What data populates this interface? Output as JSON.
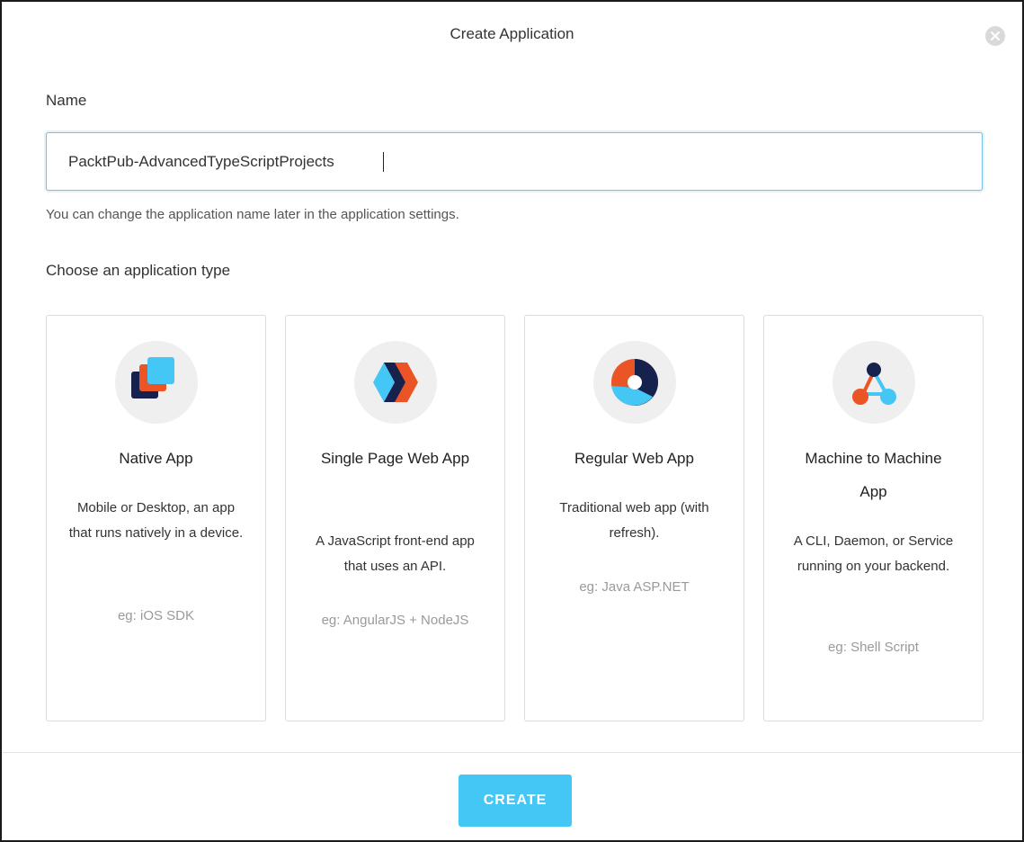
{
  "dialog": {
    "title": "Create Application",
    "close_icon": "close-icon"
  },
  "name_field": {
    "label": "Name",
    "value": "PacktPub-AdvancedTypeScriptProjects",
    "hint": "You can change the application name later in the application settings."
  },
  "app_type": {
    "label": "Choose an application type",
    "cards": [
      {
        "icon": "native-app-icon",
        "title": "Native App",
        "description": "Mobile or Desktop, an app that runs natively in a device.",
        "example": "eg: iOS SDK"
      },
      {
        "icon": "single-page-app-icon",
        "title": "Single Page Web App",
        "description": "A JavaScript front-end app that uses an API.",
        "example": "eg: AngularJS + NodeJS"
      },
      {
        "icon": "regular-web-app-icon",
        "title": "Regular Web App",
        "description": "Traditional web app (with refresh).",
        "example": "eg: Java ASP.NET"
      },
      {
        "icon": "machine-to-machine-icon",
        "title": "Machine to Machine App",
        "description": "A CLI, Daemon, or Service running on your backend.",
        "example": "eg: Shell Script"
      }
    ]
  },
  "footer": {
    "create_label": "CREATE"
  },
  "colors": {
    "accent": "#44c7f4",
    "navy": "#16214d",
    "orange": "#eb5424",
    "light_blue": "#44c7f4"
  }
}
